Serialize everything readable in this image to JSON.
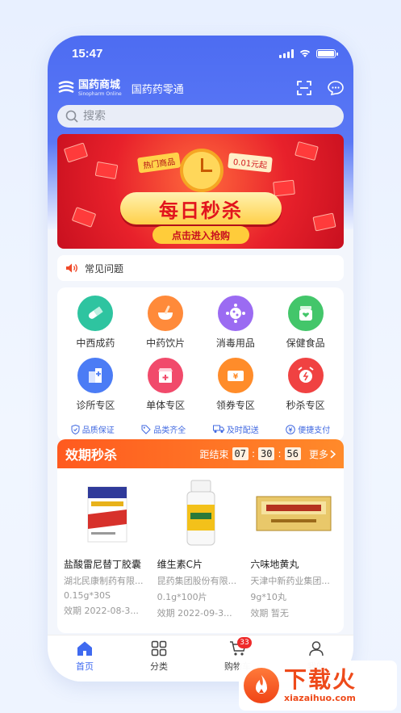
{
  "status": {
    "time": "15:47"
  },
  "header": {
    "logo_cn": "国药商城",
    "logo_en": "Sinopharm Online",
    "subtitle": "国药药零通"
  },
  "search": {
    "placeholder": "搜索"
  },
  "banner": {
    "tag": "热门商品",
    "price": "0.01元起",
    "title": "每日秒杀",
    "cta": "点击进入抢购"
  },
  "notice": {
    "label": "常见问题"
  },
  "categories": [
    {
      "label": "中西成药",
      "icon": "capsule-icon",
      "color": "#2ec4a0"
    },
    {
      "label": "中药饮片",
      "icon": "mortar-icon",
      "color": "#ff8a3a"
    },
    {
      "label": "消毒用品",
      "icon": "virus-icon",
      "color": "#9b6bf2"
    },
    {
      "label": "保健食品",
      "icon": "health-jar-icon",
      "color": "#43c66a"
    },
    {
      "label": "诊所专区",
      "icon": "clinic-icon",
      "color": "#4b7cf5"
    },
    {
      "label": "单体专区",
      "icon": "store-icon",
      "color": "#f14a6b"
    },
    {
      "label": "领券专区",
      "icon": "coupon-icon",
      "color": "#ff8c2a"
    },
    {
      "label": "秒杀专区",
      "icon": "alarm-clock-icon",
      "color": "#f04242"
    }
  ],
  "promises": [
    "品质保证",
    "品类齐全",
    "及时配送",
    "便捷支付"
  ],
  "deal": {
    "title": "效期秒杀",
    "countdown_label": "距结束",
    "hours": "07",
    "minutes": "30",
    "seconds": "56",
    "more": "更多",
    "products": [
      {
        "name": "盐酸雷尼替丁胶囊",
        "maker": "湖北民康制药有限...",
        "spec": "0.15g*30S",
        "expiry": "效期  2022-08-3..."
      },
      {
        "name": "维生素C片",
        "maker": "昆药集团股份有限...",
        "spec": "0.1g*100片",
        "expiry": "效期  2022-09-3..."
      },
      {
        "name": "六味地黄丸",
        "maker": "天津中新药业集团...",
        "spec": "9g*10丸",
        "expiry": "效期  暂无"
      }
    ]
  },
  "tabs": [
    {
      "label": "首页",
      "icon": "home-icon"
    },
    {
      "label": "分类",
      "icon": "grid-icon"
    },
    {
      "label": "购物车",
      "icon": "cart-icon",
      "badge": "33"
    },
    {
      "label": "我的",
      "icon": "user-icon"
    }
  ],
  "watermark": {
    "cn": "下载火",
    "en": "xiazaihuo.com"
  }
}
